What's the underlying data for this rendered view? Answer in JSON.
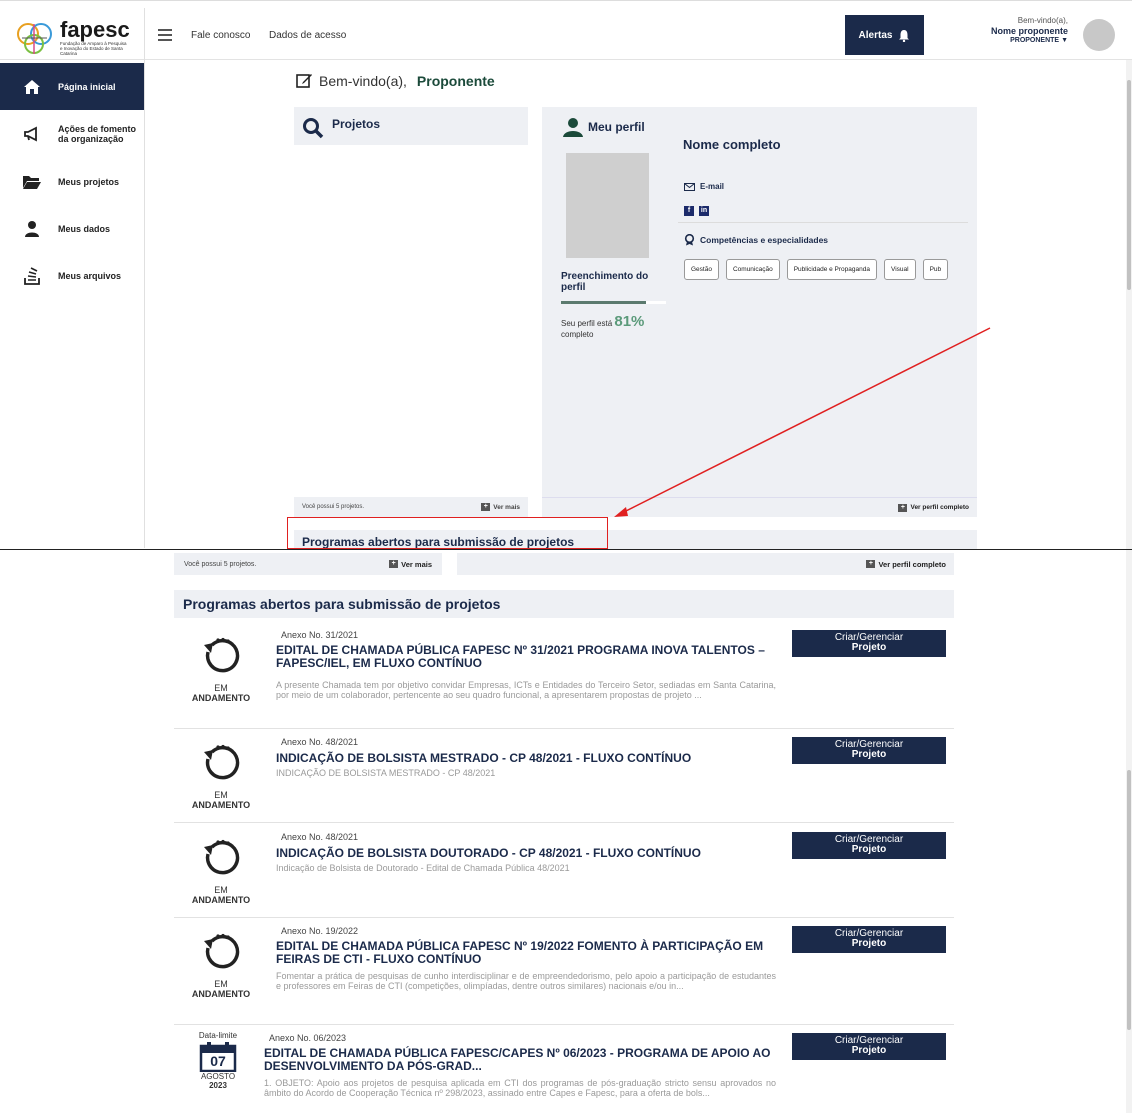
{
  "logo": {
    "name": "fapesc",
    "subtitle": "Fundação de Amparo à Pesquisa e Inovação do Estado de Santa Catarina"
  },
  "topnav": {
    "links": [
      "Fale conosco",
      "Dados de acesso"
    ],
    "alerts_label": "Alertas",
    "welcome_small": "Bem-vindo(a),",
    "user_name": "Nome proponente",
    "user_role": "PROPONENTE"
  },
  "sidebar": {
    "items": [
      {
        "label": "Página inicial",
        "icon": "home-icon"
      },
      {
        "label": "Ações de fomento da organização",
        "icon": "megaphone-icon"
      },
      {
        "label": "Meus projetos",
        "icon": "folder-icon"
      },
      {
        "label": "Meus dados",
        "icon": "user-icon"
      },
      {
        "label": "Meus arquivos",
        "icon": "archive-icon"
      }
    ]
  },
  "greeting": {
    "prefix": "Bem-vindo(a),",
    "name": "Proponente"
  },
  "projects": {
    "title": "Projetos",
    "count_text": "Você possui 5 projetos.",
    "more": "Ver mais"
  },
  "profile": {
    "title": "Meu perfil",
    "full_name": "Nome completo",
    "email_label": "E-mail",
    "fill_label": "Preenchimento do perfil",
    "complete_prefix": "Seu perfil está",
    "percent": "81%",
    "percent_value": 81,
    "complete_suffix": "completo",
    "competences_title": "Competências e especialidades",
    "chips": [
      "Gestão",
      "Comunicação",
      "Publicidade e Propaganda",
      "Visual",
      "Pub"
    ],
    "see_full": "Ver perfil completo"
  },
  "programs": {
    "title": "Programas abertos para submissão de projetos",
    "button_line1": "Criar/Gerenciar",
    "button_line2": "Projeto",
    "items": [
      {
        "status1": "EM",
        "status2": "ANDAMENTO",
        "anexo": "Anexo No. 31/2021",
        "title": "EDITAL DE CHAMADA PÚBLICA FAPESC Nº 31/2021 PROGRAMA INOVA TALENTOS – FAPESC/IEL, EM FLUXO CONTÍNUO",
        "desc": "A presente Chamada tem por objetivo convidar Empresas, ICTs e Entidades do Terceiro Setor, sediadas em Santa Catarina, por meio de um colaborador, pertencente ao seu quadro funcional, a apresentarem propostas de projeto ..."
      },
      {
        "status1": "EM",
        "status2": "ANDAMENTO",
        "anexo": "Anexo No. 48/2021",
        "title": "INDICAÇÃO DE BOLSISTA MESTRADO - CP 48/2021 - FLUXO CONTÍNUO",
        "desc": "INDICAÇÃO DE BOLSISTA MESTRADO - CP 48/2021"
      },
      {
        "status1": "EM",
        "status2": "ANDAMENTO",
        "anexo": "Anexo No. 48/2021",
        "title": "INDICAÇÃO DE BOLSISTA DOUTORADO - CP 48/2021 - FLUXO CONTÍNUO",
        "desc": "Indicação de Bolsista de Doutorado - Edital de Chamada Pública 48/2021"
      },
      {
        "status1": "EM",
        "status2": "ANDAMENTO",
        "anexo": "Anexo No. 19/2022",
        "title": "EDITAL DE CHAMADA PÚBLICA FAPESC Nº 19/2022 FOMENTO À PARTICIPAÇÃO EM FEIRAS DE CTI - FLUXO CONTÍNUO",
        "desc": "Fomentar a prática de pesquisas de cunho interdisciplinar e de empreendedorismo, pelo apoio a participação de estudantes e professores em Feiras de CTI (competições, olimpíadas, dentre outros similares) nacionais e/ou in..."
      },
      {
        "deadline_label": "Data-limite",
        "day": "07",
        "month": "AGOSTO",
        "year": "2023",
        "anexo": "Anexo No. 06/2023",
        "title": "EDITAL DE CHAMADA PÚBLICA FAPESC/CAPES Nº 06/2023 - PROGRAMA DE APOIO AO DESENVOLVIMENTO DA PÓS-GRAD...",
        "desc": "1. OBJETO: Apoio aos projetos de pesquisa aplicada em CTI dos programas de pós-graduação stricto sensu aprovados no âmbito do Acordo de Cooperação Técnica nº 298/2023, assinado entre Capes e Fapesc, para a oferta de bols..."
      }
    ]
  },
  "colors": {
    "navy": "#1b2a4a",
    "accent_green": "#5b9a7a",
    "annotation_red": "#e02020"
  }
}
